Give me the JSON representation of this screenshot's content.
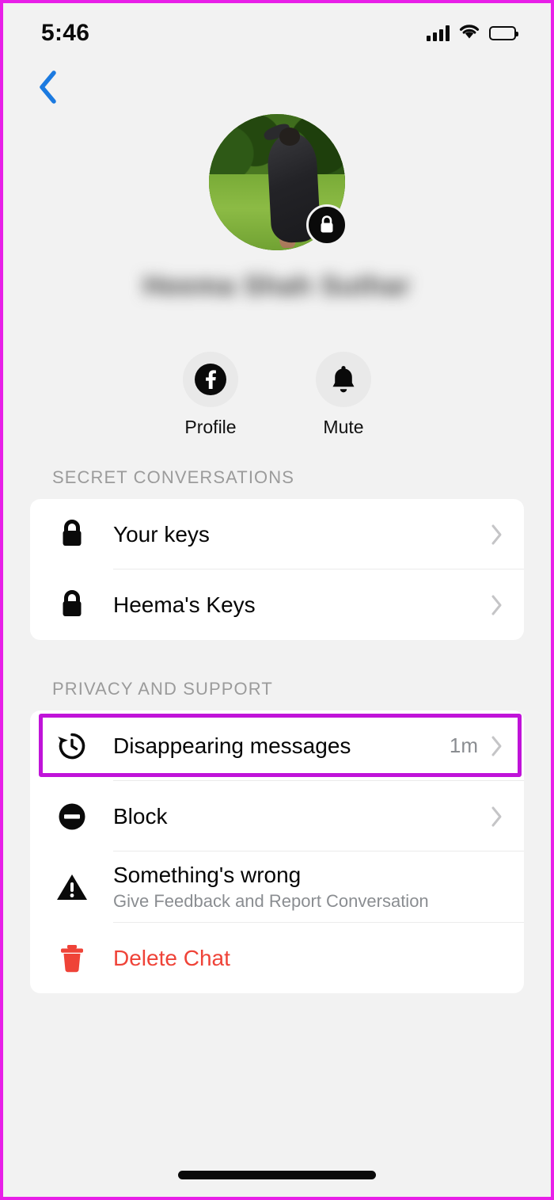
{
  "status_bar": {
    "time": "5:46",
    "signal_icon": "cellular-signal-icon",
    "wifi_icon": "wifi-icon",
    "battery_icon": "battery-icon"
  },
  "nav": {
    "back_icon": "back-chevron-icon",
    "back_color": "#1b7ae0"
  },
  "profile": {
    "name": "Heema Shah Suthar",
    "name_blurred": true,
    "avatar_badge_icon": "lock-badge-icon"
  },
  "quick_actions": [
    {
      "label": "Profile",
      "icon": "facebook-icon"
    },
    {
      "label": "Mute",
      "icon": "bell-icon"
    }
  ],
  "sections": [
    {
      "title": "SECRET CONVERSATIONS",
      "rows": [
        {
          "title": "Your keys",
          "icon": "lock-icon",
          "chevron": true
        },
        {
          "title": "Heema's Keys",
          "icon": "lock-icon",
          "chevron": true
        }
      ]
    },
    {
      "title": "PRIVACY AND SUPPORT",
      "rows": [
        {
          "title": "Disappearing messages",
          "icon": "history-clock-icon",
          "value": "1m",
          "chevron": true,
          "highlighted": true
        },
        {
          "title": "Block",
          "icon": "block-icon",
          "chevron": true
        },
        {
          "title": "Something's wrong",
          "subtitle": "Give Feedback and Report Conversation",
          "icon": "warning-triangle-icon",
          "chevron": false
        },
        {
          "title": "Delete Chat",
          "icon": "trash-icon",
          "danger": true,
          "chevron": false
        }
      ]
    }
  ],
  "annotation": {
    "highlight_color": "#c013d9",
    "target": "Disappearing messages"
  },
  "colors": {
    "background": "#f2f2f2",
    "card": "#ffffff",
    "text": "#050505",
    "secondary_text": "#8a8d91",
    "danger": "#ef4338",
    "accent_blue": "#1b7ae0"
  },
  "home_indicator": "home-indicator"
}
